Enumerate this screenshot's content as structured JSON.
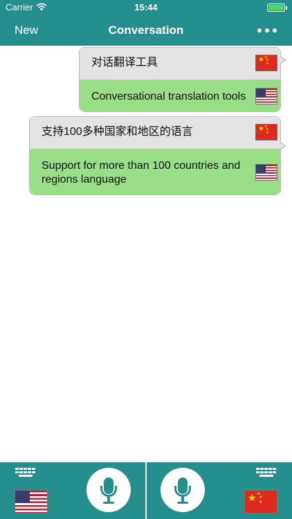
{
  "status_bar": {
    "carrier": "Carrier",
    "time": "15:44",
    "battery_color": "#4cd964"
  },
  "nav": {
    "left_button": "New",
    "title": "Conversation",
    "right_icon": "more-icon"
  },
  "conversation": [
    {
      "source_text": "对话翻译工具",
      "source_flag": "china-flag",
      "translated_text": "Conversational translation tools",
      "translated_flag": "usa-flag"
    },
    {
      "source_text": "支持100多种国家和地区的语言",
      "source_flag": "china-flag",
      "translated_text": "Support for more than 100 countries and regions language",
      "translated_flag": "usa-flag"
    }
  ],
  "bottom_bar": {
    "left": {
      "keyboard_icon": "keyboard-icon",
      "mic_icon": "microphone-icon",
      "flag": "usa-flag"
    },
    "right": {
      "keyboard_icon": "keyboard-icon",
      "mic_icon": "microphone-icon",
      "flag": "china-flag"
    }
  },
  "colors": {
    "accent": "#258f8d",
    "bubble_top": "#e3e3e3",
    "bubble_bottom": "#97de87"
  }
}
